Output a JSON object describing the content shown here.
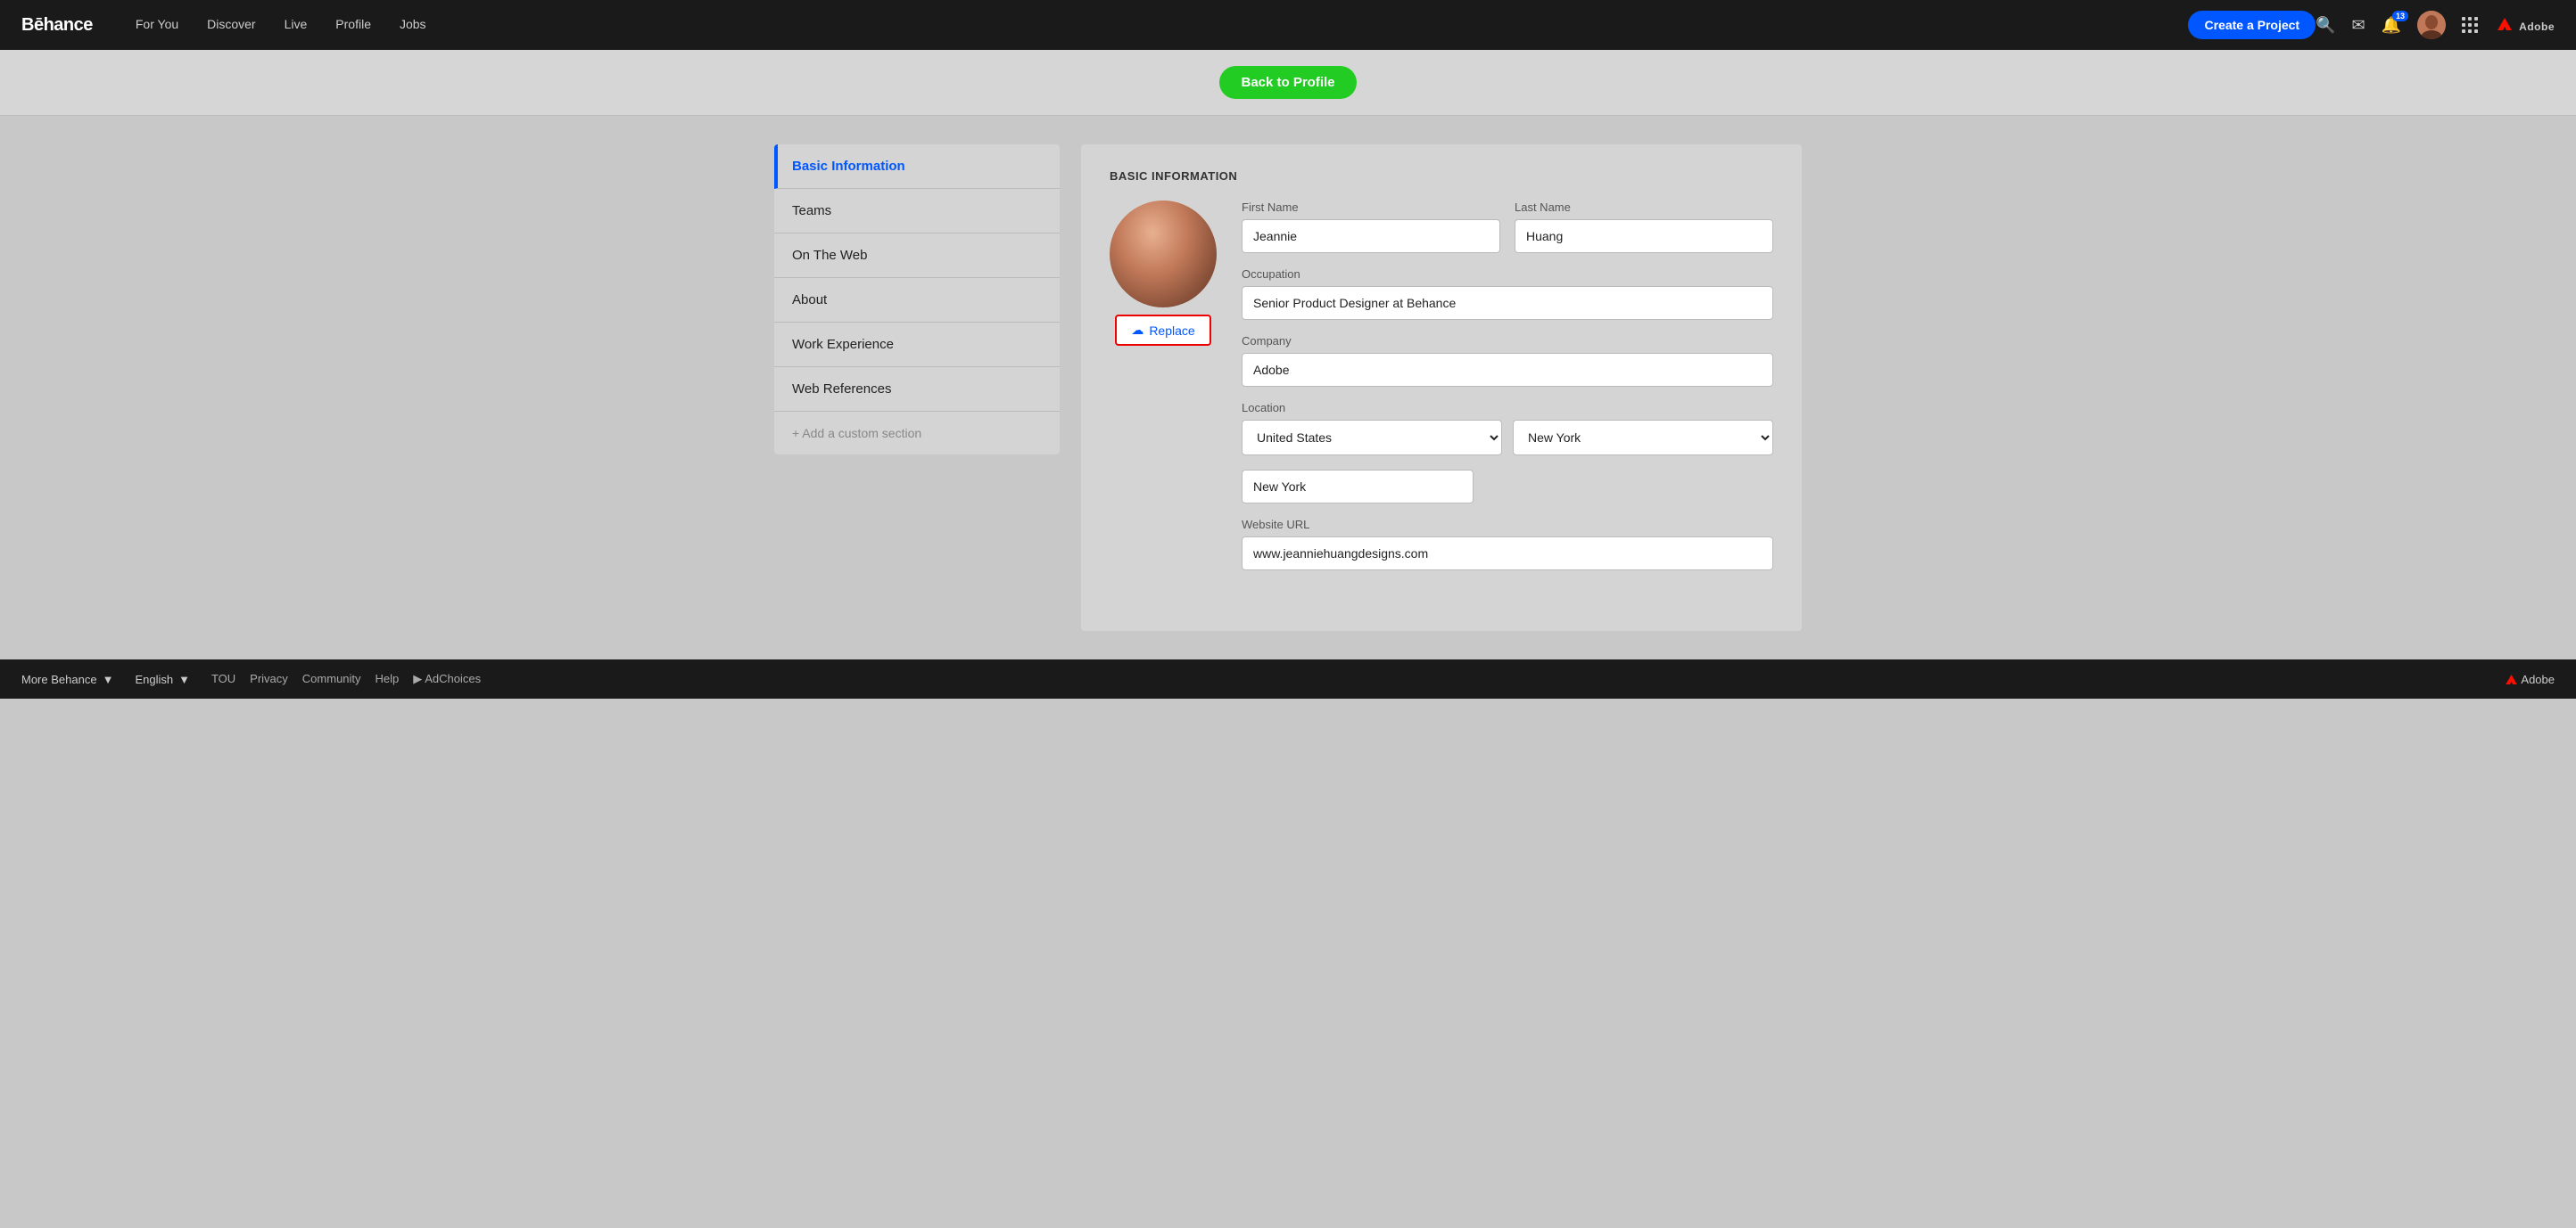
{
  "brand": "Bēhance",
  "nav": {
    "items": [
      "For You",
      "Discover",
      "Live",
      "Profile",
      "Jobs"
    ],
    "create_label": "Create a Project",
    "notification_count": "13"
  },
  "back_bar": {
    "button_label": "Back to Profile"
  },
  "sidebar": {
    "items": [
      {
        "label": "Basic Information",
        "active": true
      },
      {
        "label": "Teams",
        "active": false
      },
      {
        "label": "On The Web",
        "active": false
      },
      {
        "label": "About",
        "active": false
      },
      {
        "label": "Work Experience",
        "active": false
      },
      {
        "label": "Web References",
        "active": false
      },
      {
        "label": "+ Add a custom section",
        "active": false,
        "type": "add"
      }
    ]
  },
  "form": {
    "section_title": "BASIC INFORMATION",
    "replace_label": "Replace",
    "first_name_label": "First Name",
    "first_name_value": "Jeannie",
    "last_name_label": "Last Name",
    "last_name_value": "Huang",
    "occupation_label": "Occupation",
    "occupation_value": "Senior Product Designer at Behance",
    "company_label": "Company",
    "company_value": "Adobe",
    "location_label": "Location",
    "country_value": "United States",
    "state_value": "New York",
    "city_value": "New York",
    "website_label": "Website URL",
    "website_value": "www.jeanniehuangdesigns.com"
  },
  "footer": {
    "more_behance": "More Behance",
    "english": "English",
    "tou": "TOU",
    "privacy": "Privacy",
    "community": "Community",
    "help": "Help",
    "adchoices": "AdChoices",
    "adobe": "Adobe"
  }
}
